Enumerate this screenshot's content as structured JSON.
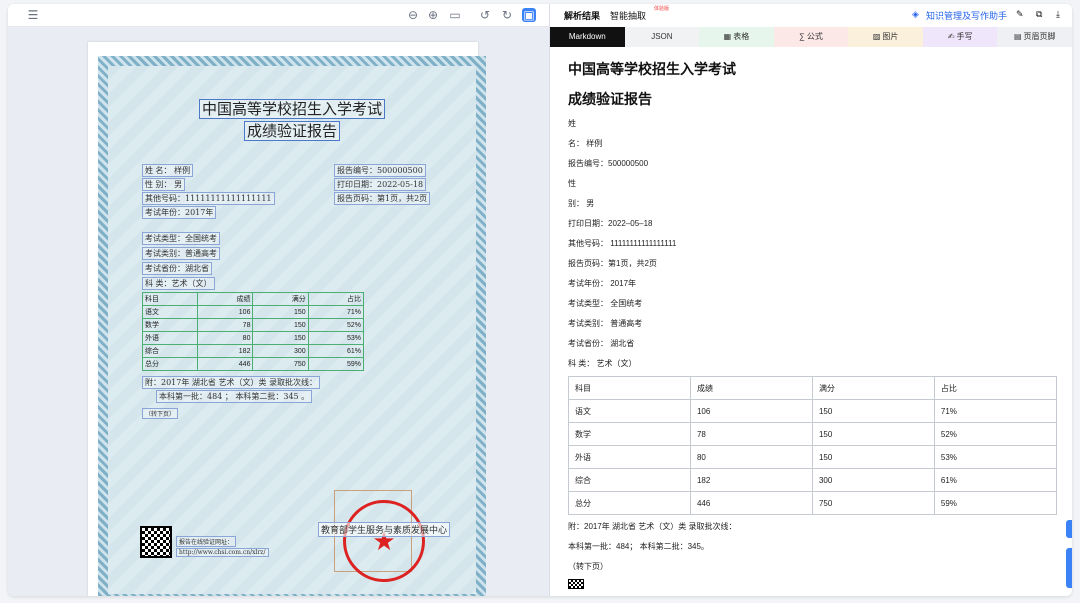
{
  "right_header": {
    "tab_results": "解析结果",
    "tab_extract": "智能抽取",
    "new_badge": "体验版",
    "assistant": "知识管理及写作助手"
  },
  "format_tabs": [
    {
      "label": "Markdown",
      "icon": ""
    },
    {
      "label": "JSON",
      "icon": ""
    },
    {
      "label": "表格",
      "icon": "table-icon",
      "bg": "#e6f6ec"
    },
    {
      "label": "公式",
      "icon": "formula-icon",
      "bg": "#fde8e8"
    },
    {
      "label": "图片",
      "icon": "image-icon",
      "bg": "#fbf0dc"
    },
    {
      "label": "手写",
      "icon": "handwriting-icon",
      "bg": "#efe6fb"
    },
    {
      "label": "页眉页脚",
      "icon": "header-footer-icon",
      "bg": "#eef0f3"
    }
  ],
  "markdown": {
    "title1": "中国高等学校招生入学考试",
    "title2": "成绩验证报告",
    "lines_before_table": [
      "姓",
      "名：  样例",
      "报告编号：500000500",
      "性",
      "别：  男",
      "打印日期：2022–05–18",
      "其他号码：  11111111111111111",
      "报告页码：第1页，共2页",
      "考试年份：  2017年",
      "考试类型：  全国统考",
      "考试类别：  普通高考",
      "考试省份：  湖北省",
      "科 类：  艺术（文）"
    ],
    "table_headers": [
      "科目",
      "成绩",
      "满分",
      "占比"
    ],
    "table_rows": [
      [
        "语文",
        "106",
        "150",
        "71%"
      ],
      [
        "数学",
        "78",
        "150",
        "52%"
      ],
      [
        "外语",
        "80",
        "150",
        "53%"
      ],
      [
        "综合",
        "182",
        "300",
        "61%"
      ],
      [
        "总分",
        "446",
        "750",
        "59%"
      ]
    ],
    "lines_after_table": [
      "附：2017年 湖北省  艺术（文）类 录取批次线：",
      "本科第一批：484；  本科第二批：345。",
      "（转下页）"
    ]
  },
  "certificate": {
    "title1": "中国高等学校招生入学考试",
    "title2": "成绩验证报告",
    "left_fields": [
      "姓   名：  样例",
      "性   别：  男",
      "其他号码：11111111111111111",
      "考试年份：2017年"
    ],
    "right_fields": [
      "报告编号：500000500",
      "打印日期：2022-05-18",
      "报告页码：第1页，共2页"
    ],
    "exam_fields": [
      "考试类型：全国统考",
      "考试类别：普通高考",
      "考试省份：湖北省",
      "科   类：艺术（文）"
    ],
    "table_headers": [
      "科目",
      "成绩",
      "满分",
      "占比"
    ],
    "table_rows": [
      [
        "语文",
        "106",
        "150",
        "71%"
      ],
      [
        "数学",
        "78",
        "150",
        "52%"
      ],
      [
        "外语",
        "80",
        "150",
        "53%"
      ],
      [
        "综合",
        "182",
        "300",
        "61%"
      ],
      [
        "总分",
        "446",
        "750",
        "59%"
      ]
    ],
    "note1": "附：2017年 湖北省 艺术（文）类 录取批次线：",
    "note2": "本科第一批：484 ；  本科第二批：345 。",
    "next_page": "（转下页）",
    "verify_label": "报告在线验证网址：",
    "verify_url": "http://www.chsi.com.cn/xlrz/",
    "stamp_text": "教育部学生服务与素质发展中心"
  }
}
